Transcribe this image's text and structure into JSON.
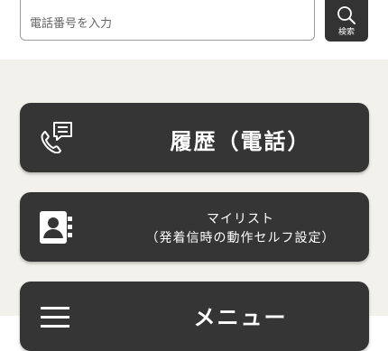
{
  "search": {
    "placeholder": "電話番号を入力",
    "button_label": "検索",
    "button_icon": "search-icon"
  },
  "buttons": {
    "history": {
      "label": "履歴（電話）",
      "icon": "phone-message-icon"
    },
    "mylist": {
      "line1": "マイリスト",
      "line2": "（発着信時の動作セルフ設定）",
      "icon": "contact-book-icon"
    },
    "menu": {
      "label": "メニュー",
      "icon": "hamburger-menu-icon"
    }
  },
  "colors": {
    "button_bg": "#353535",
    "content_bg": "#f3f1eb",
    "header_bg": "#ffffff"
  }
}
